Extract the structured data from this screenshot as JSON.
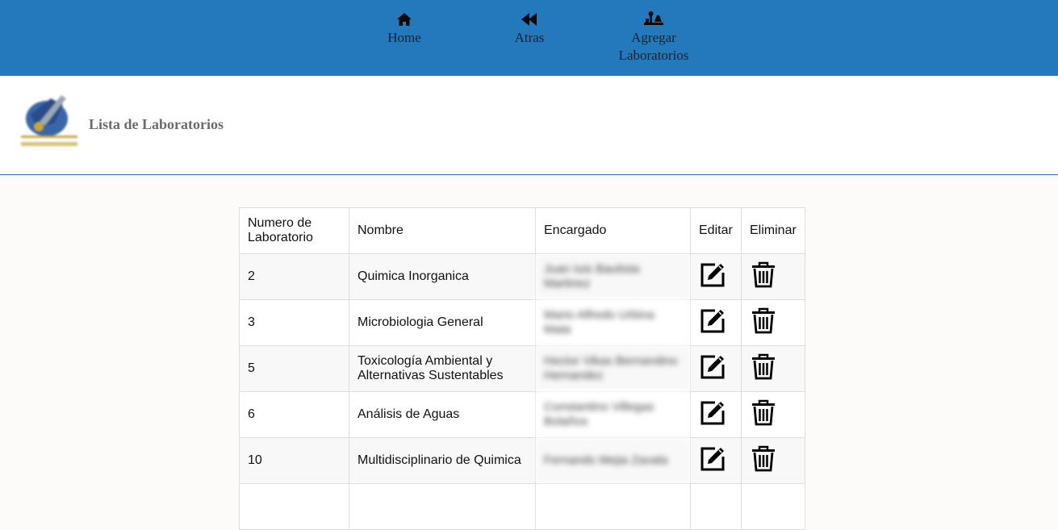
{
  "nav": {
    "home_label": "Home",
    "back_label": "Atras",
    "add_label_line1": "Agregar",
    "add_label_line2": "Laboratorios",
    "icons": [
      "home-icon",
      "rewind-icon",
      "lab-icon"
    ]
  },
  "header": {
    "title": "Lista de Laboratorios",
    "logo_icon": "university-logo"
  },
  "table": {
    "headers": {
      "numero_line1": "Numero de",
      "numero_line2": "Laboratorio",
      "nombre": "Nombre",
      "encargado": "Encargado",
      "editar": "Editar",
      "eliminar": "Eliminar"
    },
    "rows": [
      {
        "numero": "2",
        "nombre": "Quimica Inorganica",
        "encargado": "Juan Iuis Bautista Martinez"
      },
      {
        "numero": "3",
        "nombre": "Microbiologia General",
        "encargado": "Mario Alfredo Urbina Mata"
      },
      {
        "numero": "5",
        "nombre": "Toxicología Ambiental y Alternativas Sustentables",
        "encargado": "Hector Vikas Bernandino Hernandez"
      },
      {
        "numero": "6",
        "nombre": "Análisis de Aguas",
        "encargado": "Constantino Villegas Bolaños"
      },
      {
        "numero": "10",
        "nombre": "Multidisciplinario de Quimica",
        "encargado": "Fernando Mejia Zavala"
      }
    ],
    "action_icons": [
      "edit-icon",
      "trash-icon"
    ]
  },
  "colors": {
    "nav_bg": "#2479bd",
    "page_bg": "#fdfafa",
    "title": "#6b6b6b",
    "row_alt": "#f8f8f8"
  }
}
